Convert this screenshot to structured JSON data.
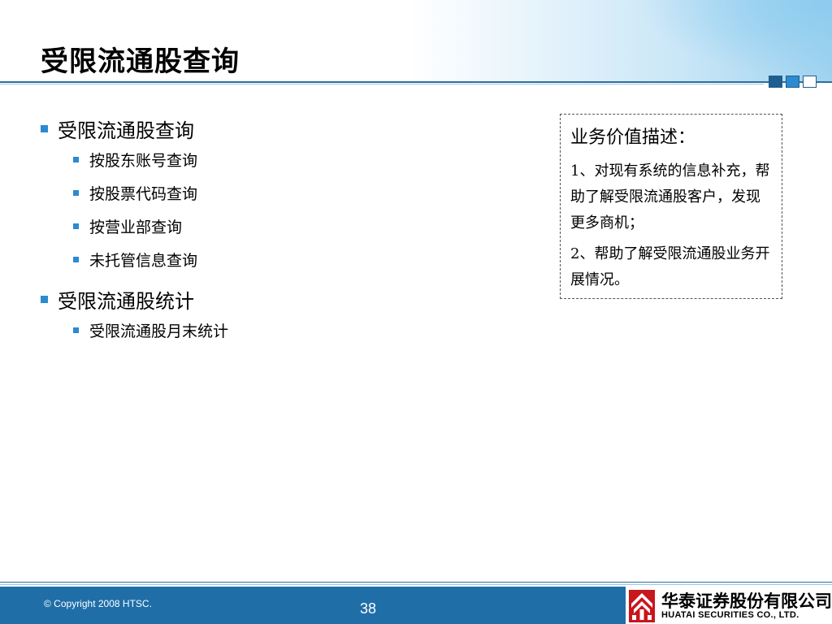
{
  "slide": {
    "title": "受限流通股查询",
    "outline": [
      {
        "label": "受限流通股查询",
        "children": [
          "按股东账号查询",
          "按股票代码查询",
          "按营业部查询",
          "未托管信息查询"
        ]
      },
      {
        "label": "受限流通股统计",
        "children": [
          "受限流通股月末统计"
        ]
      }
    ],
    "value_box": {
      "heading": "业务价值描述：",
      "paragraphs": [
        "1、对现有系统的信息补充，帮助了解受限流通股客户，发现更多商机；",
        "2、帮助了解受限流通股业务开展情况。"
      ]
    }
  },
  "footer": {
    "copyright": "© Copyright 2008 HTSC.",
    "page_number": "38",
    "logo_cn": "华泰证券股份有限公司",
    "logo_en": "HUATAI SECURITIES CO., LTD."
  },
  "icons": {
    "bullet": "blue-square-bullet-icon",
    "title_decor": "three-squares-icon",
    "logo": "huatai-logo-icon"
  },
  "colors": {
    "accent_blue": "#2c8ad0",
    "dark_blue": "#1f6ea8",
    "logo_red": "#c8161d"
  }
}
